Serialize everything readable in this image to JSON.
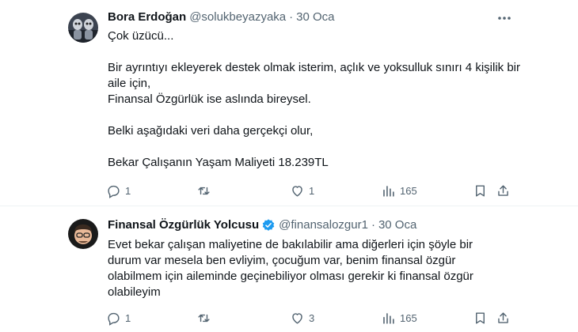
{
  "tweets": [
    {
      "name": "Bora Erdoğan",
      "handle": "@solukbeyazyaka",
      "separator": "·",
      "date": "30 Oca",
      "verified": false,
      "text": "Çok üzücü...\n\nBir ayrıntıyı ekleyerek destek olmak isterim, açlık ve yoksulluk sınırı 4 kişilik bir aile için,\nFinansal Özgürlük ise aslında bireysel.\n\nBelki aşağıdaki veri daha gerçekçi olur,\n\nBekar Çalışanın Yaşam Maliyeti 18.239TL",
      "replies": "1",
      "retweets": "",
      "likes": "1",
      "views": "165"
    },
    {
      "name": "Finansal Özgürlük Yolcusu",
      "handle": "@finansalozgur1",
      "separator": "·",
      "date": "30 Oca",
      "verified": true,
      "text": "Evet bekar çalışan maliyetine de bakılabilir ama diğerleri için şöyle bir\ndurum var mesela ben evliyim, çocuğum var, benim finansal özgür\nolabilmem için aileminde geçinebiliyor olması gerekir ki finansal özgür\nolabileyim",
      "replies": "1",
      "retweets": "",
      "likes": "3",
      "views": "165"
    }
  ],
  "colors": {
    "text": "#0f1419",
    "muted": "#536471",
    "verified": "#1d9bf0",
    "divider": "#eff3f4"
  },
  "icons": [
    "more-icon",
    "reply-icon",
    "retweet-icon",
    "like-icon",
    "views-icon",
    "bookmark-icon",
    "share-icon",
    "verified-badge-icon"
  ]
}
